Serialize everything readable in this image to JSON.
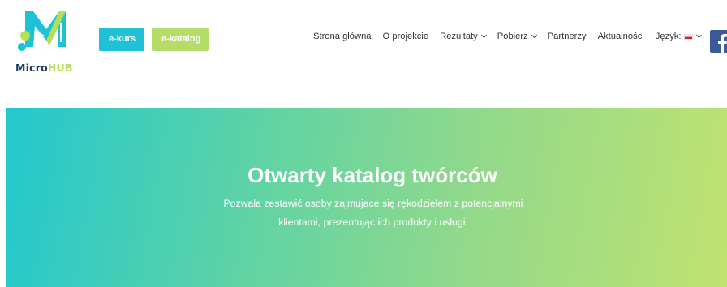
{
  "brand": {
    "logo_word1": "Micro",
    "logo_word2": "HUB",
    "colors": {
      "teal": "#1ec1d6",
      "lime": "#b6dc68",
      "navy": "#1f3b64",
      "facebook": "#3b5a98"
    }
  },
  "buttons": {
    "ekurs_label": "e-kurs",
    "ekatalog_label": "e-katalog"
  },
  "nav": {
    "home": "Strona główna",
    "about": "O projekcie",
    "results": "Rezultaty",
    "download": "Pobierz",
    "partners": "Partnerzy",
    "news": "Aktualności",
    "language": "Język:"
  },
  "social": {
    "facebook_icon": "facebook-icon",
    "facebook_glyph": "f"
  },
  "hero": {
    "title": "Otwarty katalog twórców",
    "description_line1": "Pozwala zestawić osoby zajmujące się rękodziełem z potencjalnymi",
    "description_line2": "klientami, prezentując ich produkty i usługi."
  }
}
